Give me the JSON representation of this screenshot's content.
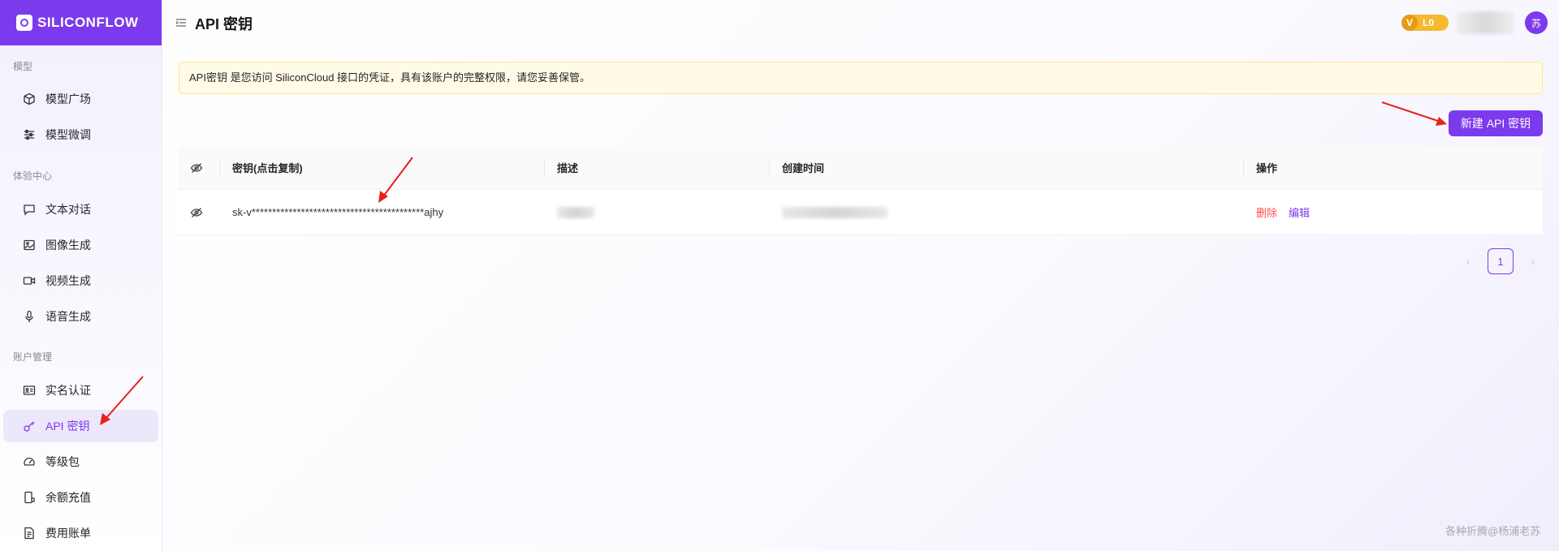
{
  "brand": {
    "name": "SILICONFLOW",
    "color": "#7c3aed"
  },
  "sidebar": {
    "sections": [
      {
        "title": "模型",
        "items": [
          {
            "label": "模型广场",
            "icon": "cube-icon"
          },
          {
            "label": "模型微调",
            "icon": "sliders-icon"
          }
        ]
      },
      {
        "title": "体验中心",
        "items": [
          {
            "label": "文本对话",
            "icon": "chat-icon"
          },
          {
            "label": "图像生成",
            "icon": "image-icon"
          },
          {
            "label": "视频生成",
            "icon": "video-icon"
          },
          {
            "label": "语音生成",
            "icon": "mic-icon"
          }
        ]
      },
      {
        "title": "账户管理",
        "items": [
          {
            "label": "实名认证",
            "icon": "id-card-icon"
          },
          {
            "label": "API 密钥",
            "icon": "key-icon",
            "active": true
          },
          {
            "label": "等级包",
            "icon": "gauge-icon"
          },
          {
            "label": "余额充值",
            "icon": "recharge-icon"
          },
          {
            "label": "费用账单",
            "icon": "bill-icon"
          }
        ]
      }
    ]
  },
  "header": {
    "title": "API 密钥",
    "level": "L0",
    "level_letter": "V",
    "avatar_text": "苏"
  },
  "notice": "API密钥 是您访问 SiliconCloud 接口的凭证，具有该账户的完整权限，请您妥善保管。",
  "actions": {
    "new_key": "新建 API 密钥"
  },
  "table": {
    "columns": [
      "密钥(点击复制)",
      "描述",
      "创建时间",
      "操作"
    ],
    "rows": [
      {
        "key": "sk-v******************************************ajhy",
        "delete": "删除",
        "edit": "编辑"
      }
    ]
  },
  "pagination": {
    "current": "1"
  },
  "watermark": "各种折腾@杨浦老苏"
}
